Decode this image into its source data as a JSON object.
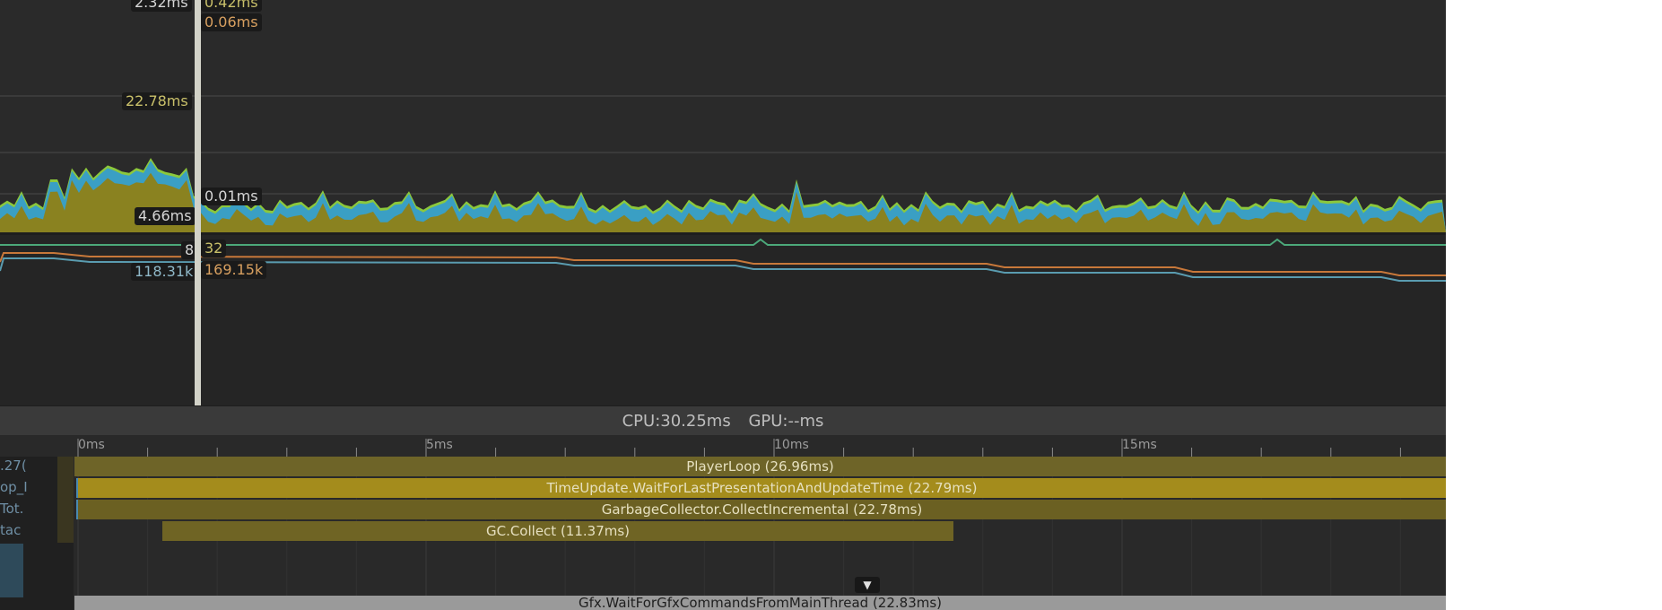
{
  "cpu_chart": {
    "labels": {
      "top_left_value": "2.32ms",
      "top_right_value": "0.42ms",
      "right_value_2": "0.06ms",
      "left_value_3": "22.78ms",
      "right_value_4": "0.01ms",
      "left_value_5": "4.66ms"
    },
    "colors": {
      "yellow": "#8a8220",
      "blue": "#3a9fc4",
      "green": "#8cc83c"
    }
  },
  "memory_chart": {
    "labels": {
      "count_left": "8",
      "count_right": "32",
      "memory_left": "118.31k",
      "memory_right": "169.15k"
    },
    "colors": {
      "orange": "#c8783a",
      "blue": "#5a9cb0",
      "green": "#4ca87a"
    }
  },
  "status": {
    "cpu": "CPU:30.25ms",
    "gpu": "GPU:--ms"
  },
  "timeline": {
    "ruler_ticks": [
      "0ms",
      "5ms",
      "10ms",
      "15ms"
    ],
    "sidebar_stub_texts": [
      ".27(",
      "op_I",
      "Tot.",
      "tac"
    ],
    "bars": [
      {
        "label": "PlayerLoop (26.96ms)",
        "color": "#6e6428"
      },
      {
        "label": "TimeUpdate.WaitForLastPresentationAndUpdateTime (22.79ms)",
        "color": "#a48c1c"
      },
      {
        "label": "GarbageCollector.CollectIncremental (22.78ms)",
        "color": "#6b6022"
      },
      {
        "label": "GC.Collect (11.37ms)",
        "color": "#6f6424"
      }
    ],
    "bottom_bar_label": "Gfx.WaitForGfxCommandsFromMainThread (22.83ms)",
    "expand_icon": "chevron-down-icon"
  }
}
